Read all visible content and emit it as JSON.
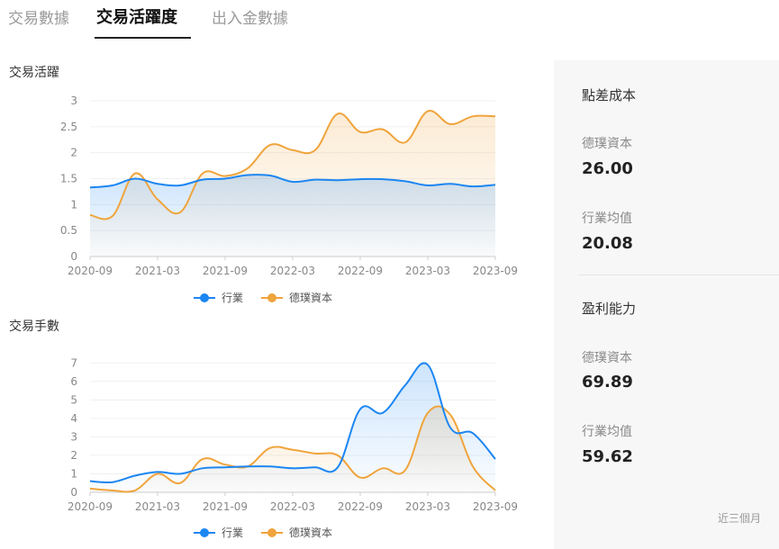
{
  "tabs": [
    {
      "label": "交易數據"
    },
    {
      "label": "交易活躍度"
    },
    {
      "label": "出入金數據"
    }
  ],
  "colors": {
    "industry": "#1c86f2",
    "firm": "#f0a43c"
  },
  "charts": [
    {
      "title": "交易活躍",
      "legend": [
        "行業",
        "德璞資本"
      ]
    },
    {
      "title": "交易手數",
      "legend": [
        "行業",
        "德璞資本"
      ]
    }
  ],
  "side": {
    "section1": {
      "title": "點差成本",
      "firm_label": "德璞資本",
      "firm_value": "26.00",
      "industry_label": "行業均值",
      "industry_value": "20.08"
    },
    "section2": {
      "title": "盈利能力",
      "firm_label": "德璞資本",
      "firm_value": "69.89",
      "industry_label": "行業均值",
      "industry_value": "59.62"
    },
    "period": "近三個月"
  },
  "chart_data": [
    {
      "type": "area",
      "title": "交易活躍",
      "x_ticks": [
        "2020-09",
        "2021-03",
        "2021-09",
        "2022-03",
        "2022-09",
        "2023-03",
        "2023-09"
      ],
      "y_ticks": [
        "0",
        "0.5",
        "1",
        "1.5",
        "2",
        "2.5",
        "3"
      ],
      "ylim": [
        0,
        3
      ],
      "x_range": [
        "2020-09",
        "2023-09"
      ],
      "series": [
        {
          "name": "行業",
          "x": [
            "2020-09",
            "2020-11",
            "2021-01",
            "2021-03",
            "2021-05",
            "2021-07",
            "2021-09",
            "2021-11",
            "2022-01",
            "2022-03",
            "2022-05",
            "2022-07",
            "2022-09",
            "2022-11",
            "2023-01",
            "2023-03",
            "2023-05",
            "2023-07",
            "2023-09"
          ],
          "values": [
            1.33,
            1.37,
            1.5,
            1.4,
            1.37,
            1.48,
            1.5,
            1.57,
            1.56,
            1.44,
            1.48,
            1.47,
            1.49,
            1.49,
            1.45,
            1.37,
            1.4,
            1.35,
            1.38
          ]
        },
        {
          "name": "德璞資本",
          "x": [
            "2020-09",
            "2020-11",
            "2021-01",
            "2021-03",
            "2021-05",
            "2021-07",
            "2021-09",
            "2021-11",
            "2022-01",
            "2022-03",
            "2022-05",
            "2022-07",
            "2022-09",
            "2022-11",
            "2023-01",
            "2023-03",
            "2023-05",
            "2023-07",
            "2023-09"
          ],
          "values": [
            0.8,
            0.78,
            1.6,
            1.1,
            0.85,
            1.6,
            1.55,
            1.7,
            2.15,
            2.05,
            2.05,
            2.75,
            2.4,
            2.45,
            2.2,
            2.8,
            2.55,
            2.7,
            2.7
          ]
        }
      ]
    },
    {
      "type": "area",
      "title": "交易手數",
      "x_ticks": [
        "2020-09",
        "2021-03",
        "2021-09",
        "2022-03",
        "2022-09",
        "2023-03",
        "2023-09"
      ],
      "y_ticks": [
        "0",
        "1",
        "2",
        "3",
        "4",
        "5",
        "6",
        "7"
      ],
      "ylim": [
        0,
        7.5
      ],
      "x_range": [
        "2020-09",
        "2023-09"
      ],
      "series": [
        {
          "name": "行業",
          "x": [
            "2020-09",
            "2020-11",
            "2021-01",
            "2021-03",
            "2021-05",
            "2021-07",
            "2021-09",
            "2021-11",
            "2022-01",
            "2022-03",
            "2022-05",
            "2022-07",
            "2022-09",
            "2022-11",
            "2023-01",
            "2023-03",
            "2023-05",
            "2023-07",
            "2023-09"
          ],
          "values": [
            0.6,
            0.55,
            0.9,
            1.1,
            1.0,
            1.3,
            1.35,
            1.4,
            1.4,
            1.3,
            1.35,
            1.35,
            4.5,
            4.3,
            5.8,
            6.9,
            3.5,
            3.2,
            1.8
          ]
        },
        {
          "name": "德璞資本",
          "x": [
            "2020-09",
            "2020-11",
            "2021-01",
            "2021-03",
            "2021-05",
            "2021-07",
            "2021-09",
            "2021-11",
            "2022-01",
            "2022-03",
            "2022-05",
            "2022-07",
            "2022-09",
            "2022-11",
            "2023-01",
            "2023-03",
            "2023-05",
            "2023-07",
            "2023-09"
          ],
          "values": [
            0.2,
            0.1,
            0.1,
            1.0,
            0.5,
            1.8,
            1.5,
            1.4,
            2.4,
            2.3,
            2.1,
            2.0,
            0.8,
            1.3,
            1.2,
            4.3,
            4.2,
            1.4,
            0.1
          ]
        }
      ]
    }
  ]
}
